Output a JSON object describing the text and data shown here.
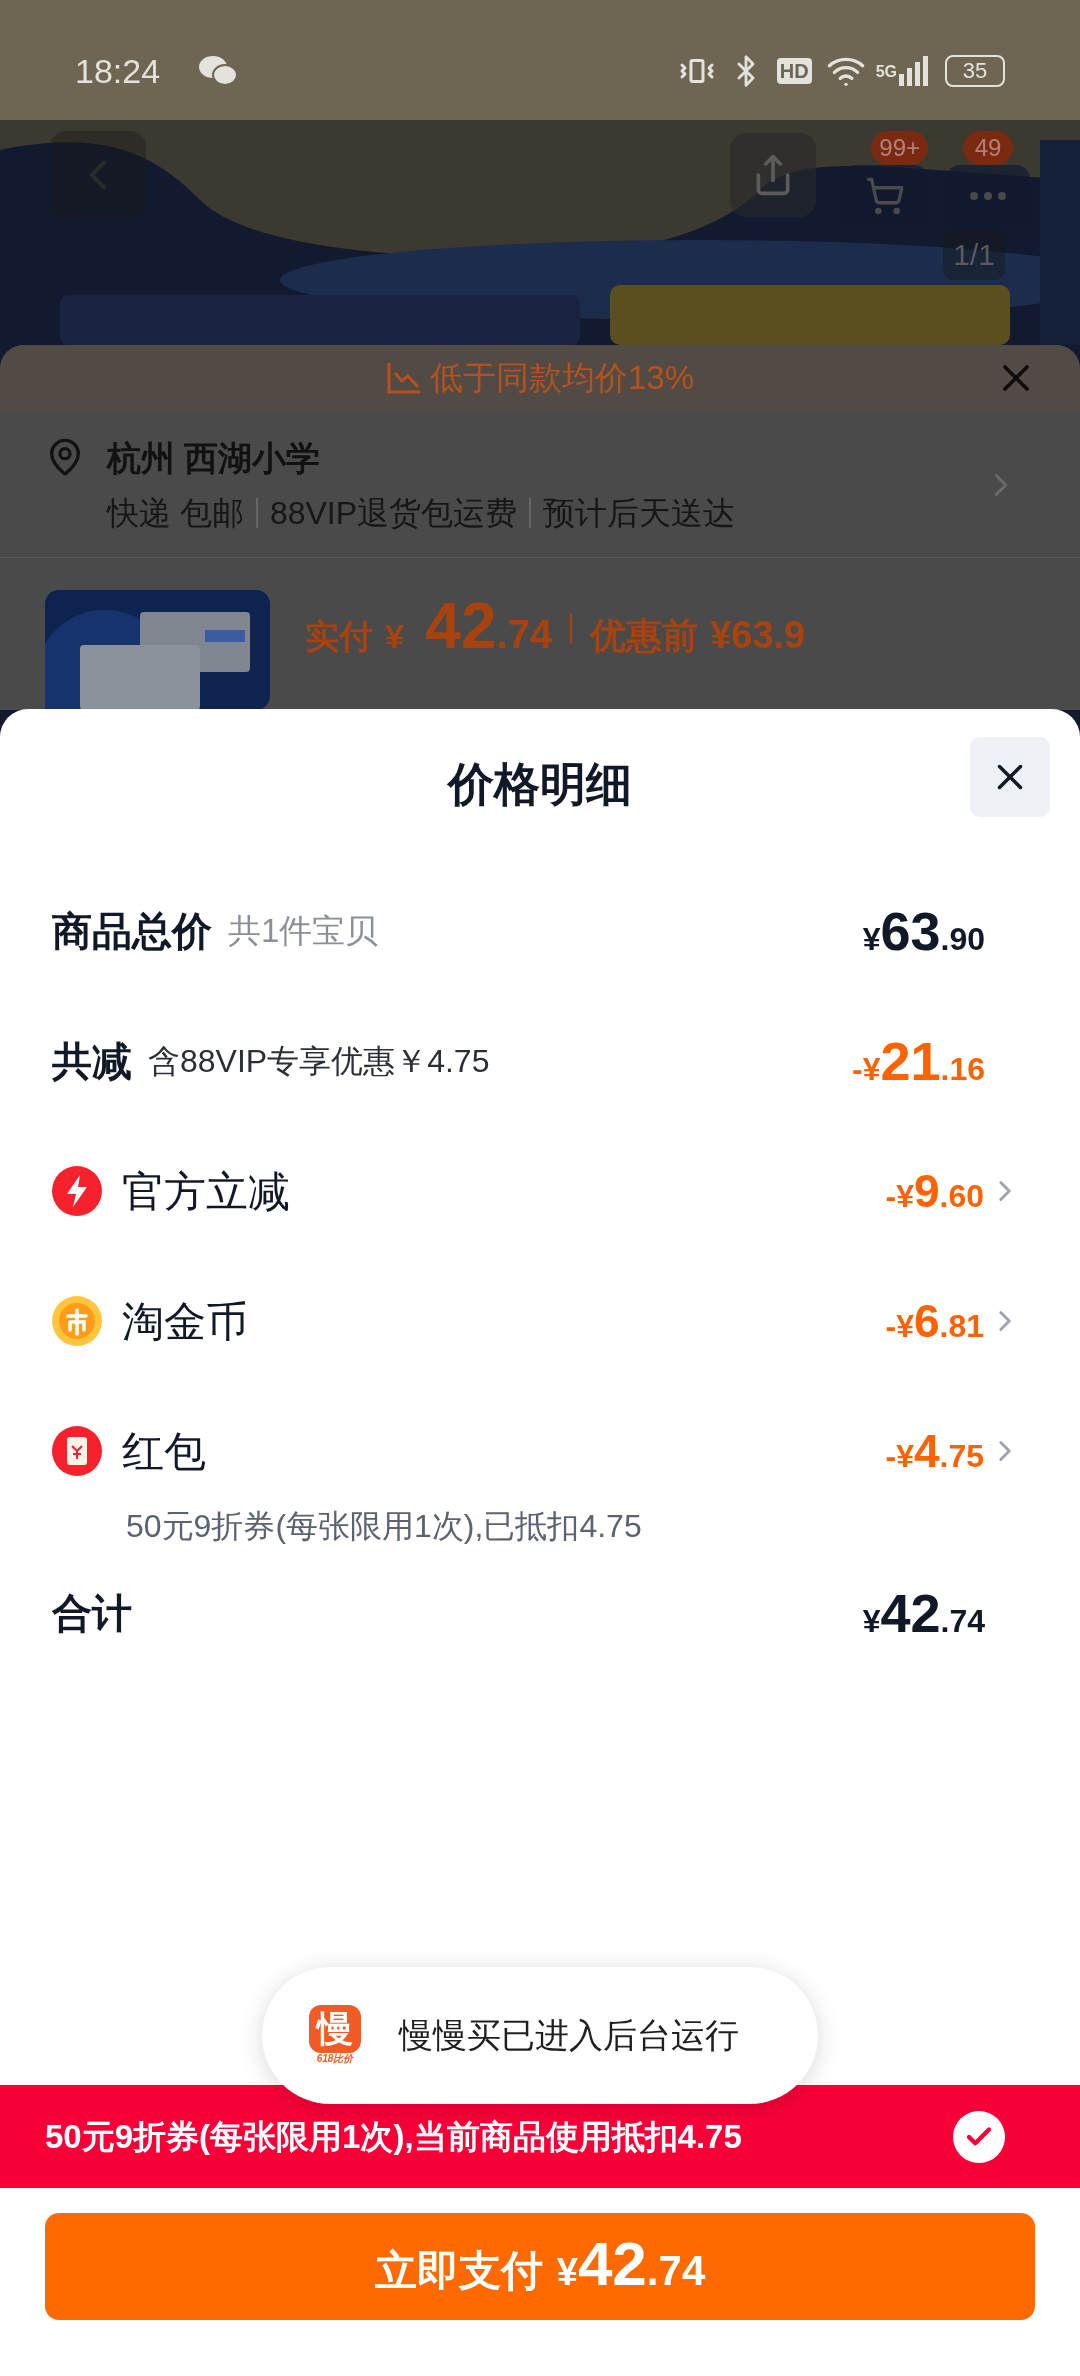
{
  "status_bar": {
    "time": "18:24",
    "hd": "HD",
    "network": "5G",
    "battery": "35"
  },
  "product_header": {
    "kind": "picture",
    "cart_badge": "99+",
    "more_badge": "49",
    "page_indicator": "1/1"
  },
  "order_sheet": {
    "notice": "低于同款均价13%",
    "address": "杭州 西湖小学",
    "delivery": [
      "快递 包邮",
      "88VIP退货包运费",
      "预计后天送达"
    ],
    "price_label": "实付",
    "price": "¥ 42.74",
    "original_label": "优惠前",
    "original_price": "¥63.9"
  },
  "price_detail": {
    "title": "价格明细",
    "rows": [
      {
        "kind": "total",
        "label": "商品总价",
        "note": "共1件宝贝",
        "amount": "¥63.90"
      },
      {
        "kind": "discount_total",
        "label": "共减",
        "note": "含88VIP专享优惠￥4.75",
        "amount": "-¥21.16"
      },
      {
        "kind": "instant_discount",
        "label": "官方立减",
        "amount": "-¥9.60"
      },
      {
        "kind": "coins",
        "label": "淘金币",
        "amount": "-¥6.81"
      },
      {
        "kind": "red_envelope",
        "label": "红包",
        "amount": "-¥4.75",
        "detail": "50元9折券(每张限用1次),已抵扣4.75"
      }
    ],
    "sum": {
      "label": "合计",
      "amount": "¥42.74"
    }
  },
  "toast": {
    "app_icon_text": "慢",
    "app_icon_caption": "618比价",
    "message": "慢慢买已进入后台运行"
  },
  "coupon_bar": {
    "text": "50元9折券(每张限用1次),当前商品使用抵扣4.75",
    "checked": true
  },
  "pay_button": {
    "label": "立即支付",
    "amount": "¥42.74"
  }
}
